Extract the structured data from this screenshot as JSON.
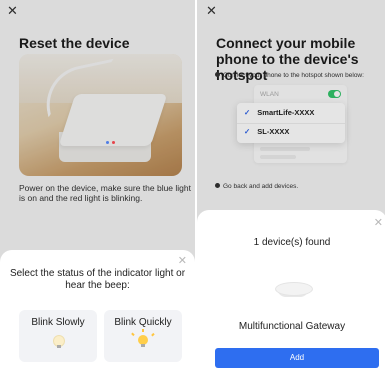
{
  "left": {
    "close_icon": "close-icon",
    "title": "Reset the device",
    "description": "Power on the device, make sure the blue light is on and the red light is blinking.",
    "sheet": {
      "close_icon": "close-icon",
      "question": "Select the status of the indicator light or hear the beep:",
      "options": [
        {
          "label": "Blink Slowly",
          "icon": "bulb-dim-icon"
        },
        {
          "label": "Blink Quickly",
          "icon": "bulb-lit-icon"
        }
      ]
    }
  },
  "right": {
    "close_icon": "close-icon",
    "title": "Connect your mobile phone to the device's hotspot",
    "step1": "Connect your phone to the hotspot shown below:",
    "wlan_label": "WLAN",
    "networks": [
      "SmartLife-XXXX",
      "SL-XXXX"
    ],
    "step2": "Go back and add devices.",
    "sheet": {
      "close_icon": "close-icon",
      "found_text": "1 device(s) found",
      "device_name": "Multifunctional Gateway",
      "add_label": "Add"
    }
  },
  "colors": {
    "accent": "#2e6ef0",
    "check": "#2f64e8",
    "toggle_on": "#33c46a",
    "led_blue": "#5a8cff",
    "led_red": "#ff4d55",
    "bulb": "#ffce4a"
  }
}
